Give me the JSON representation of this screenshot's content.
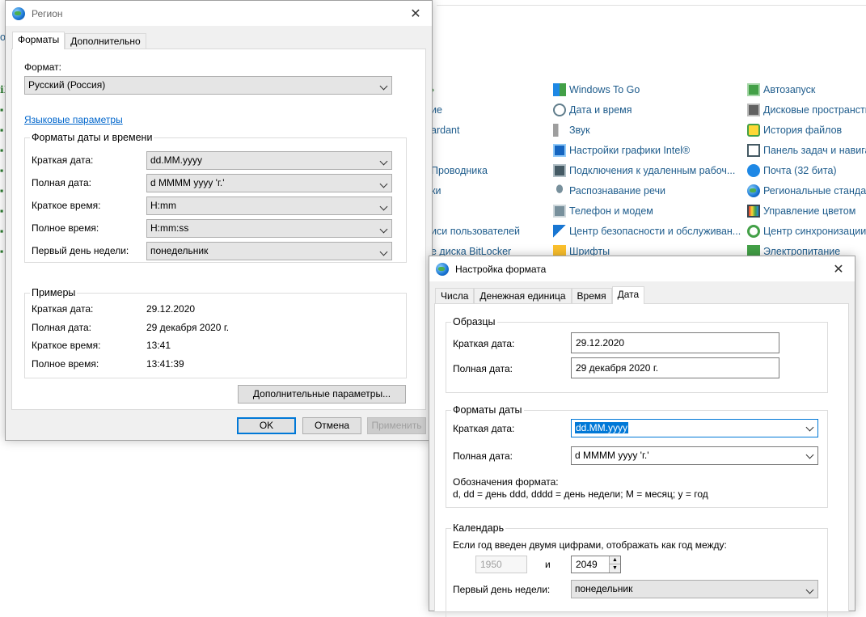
{
  "control_panel": {
    "left_fragments": [
      "o",
      "×",
      "ие",
      "ardant",
      "Проводника",
      "ки",
      "иси пользователей",
      "е диска BitLocker"
    ],
    "column2": [
      {
        "label": "Windows To Go",
        "icon": "windows-to-go-icon"
      },
      {
        "label": "Дата и время",
        "icon": "clock-icon"
      },
      {
        "label": "Звук",
        "icon": "speaker-icon"
      },
      {
        "label": "Настройки графики Intel®",
        "icon": "intel-graphics-icon"
      },
      {
        "label": "Подключения к удаленным рабоч...",
        "icon": "remote-desktop-icon"
      },
      {
        "label": "Распознавание речи",
        "icon": "microphone-icon"
      },
      {
        "label": "Телефон и модем",
        "icon": "phone-modem-icon"
      },
      {
        "label": "Центр безопасности и обслуживан...",
        "icon": "flag-icon"
      },
      {
        "label": "Шрифты",
        "icon": "fonts-icon"
      }
    ],
    "column3": [
      {
        "label": "Автозапуск",
        "icon": "autoplay-icon"
      },
      {
        "label": "Дисковые пространства",
        "icon": "storage-spaces-icon"
      },
      {
        "label": "История файлов",
        "icon": "file-history-icon"
      },
      {
        "label": "Панель задач и навигац",
        "icon": "taskbar-icon"
      },
      {
        "label": "Почта (32 бита)",
        "icon": "mail-icon"
      },
      {
        "label": "Региональные стандарт",
        "icon": "region-icon"
      },
      {
        "label": "Управление цветом",
        "icon": "color-management-icon"
      },
      {
        "label": "Центр синхронизации",
        "icon": "sync-center-icon"
      },
      {
        "label": "Электропитание",
        "icon": "power-icon"
      }
    ]
  },
  "region_dialog": {
    "title": "Регион",
    "tabs": [
      "Форматы",
      "Дополнительно"
    ],
    "format_label": "Формат:",
    "format_value": "Русский (Россия)",
    "language_link": "Языковые параметры",
    "datetime_group": "Форматы даты и времени",
    "rows": [
      {
        "label": "Краткая дата:",
        "value": "dd.MM.yyyy"
      },
      {
        "label": "Полная дата:",
        "value": "d MMMM yyyy 'г.'"
      },
      {
        "label": "Краткое время:",
        "value": "H:mm"
      },
      {
        "label": "Полное время:",
        "value": "H:mm:ss"
      },
      {
        "label": "Первый день недели:",
        "value": "понедельник"
      }
    ],
    "examples_group": "Примеры",
    "examples": [
      {
        "label": "Краткая дата:",
        "value": "29.12.2020"
      },
      {
        "label": "Полная дата:",
        "value": "29 декабря 2020 г."
      },
      {
        "label": "Краткое время:",
        "value": "13:41"
      },
      {
        "label": "Полное время:",
        "value": "13:41:39"
      }
    ],
    "advanced_button": "Дополнительные параметры...",
    "ok": "OK",
    "cancel": "Отмена",
    "apply": "Применить"
  },
  "format_dialog": {
    "title": "Настройка формата",
    "tabs": [
      "Числа",
      "Денежная единица",
      "Время",
      "Дата"
    ],
    "samples_group": "Образцы",
    "samples": [
      {
        "label": "Краткая дата:",
        "value": "29.12.2020"
      },
      {
        "label": "Полная дата:",
        "value": "29 декабря 2020 г."
      }
    ],
    "formats_group": "Форматы даты",
    "short_date_label": "Краткая дата:",
    "short_date_value": "dd.MM.yyyy",
    "long_date_label": "Полная дата:",
    "long_date_value": "d MMMM yyyy 'г.'",
    "notation_title": "Обозначения формата:",
    "notation_text": "d, dd = день  ddd, dddd = день недели; M = месяц; y = год",
    "calendar_group": "Календарь",
    "two_digit_text": "Если год введен двумя цифрами, отображать как год между:",
    "year_from": "1950",
    "and": "и",
    "year_to": "2049",
    "first_day_label": "Первый день недели:",
    "first_day_value": "понедельник"
  }
}
